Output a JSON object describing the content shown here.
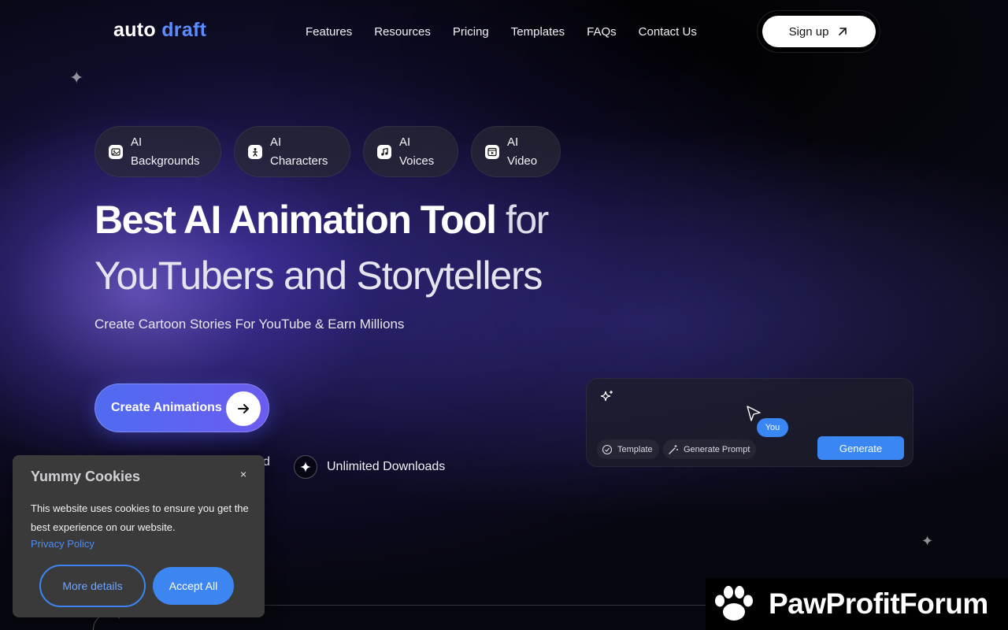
{
  "brand": {
    "word1": "auto",
    "word2": "draft"
  },
  "nav": {
    "links": [
      "Features",
      "Resources",
      "Pricing",
      "Templates",
      "FAQs",
      "Contact Us"
    ],
    "signup_label": "Sign up"
  },
  "pills": [
    {
      "line1": "AI",
      "line2": "Backgrounds",
      "icon": "image-icon"
    },
    {
      "line1": "AI",
      "line2": "Characters",
      "icon": "person-icon"
    },
    {
      "line1": "AI",
      "line2": "Voices",
      "icon": "music-icon"
    },
    {
      "line1": "AI",
      "line2": "Video",
      "icon": "video-icon"
    }
  ],
  "hero": {
    "title_bold": "Best AI Animation Tool",
    "title_light": " for",
    "title_line2": "YouTubers and Storytellers",
    "subtitle": "Create Cartoon Stories For YouTube & Earn Millions",
    "cta_label": "Create Animations",
    "feature_partial": "d",
    "feature": "Unlimited Downloads"
  },
  "prompt_panel": {
    "you_label": "You",
    "template_label": "Template",
    "generate_prompt_label": "Generate Prompt",
    "generate_label": "Generate"
  },
  "cookie": {
    "title": "Yummy Cookies",
    "close": "×",
    "body": "This website uses cookies to ensure you get the best experience on our website.",
    "privacy_link": "Privacy Policy",
    "more_details": "More details",
    "accept_all": "Accept All"
  },
  "watermark": {
    "text": "PawProfitForum"
  },
  "colors": {
    "accent_blue": "#3a86f2",
    "brand_blue": "#5b8dff",
    "cta_purple": "#6b5cf0"
  }
}
